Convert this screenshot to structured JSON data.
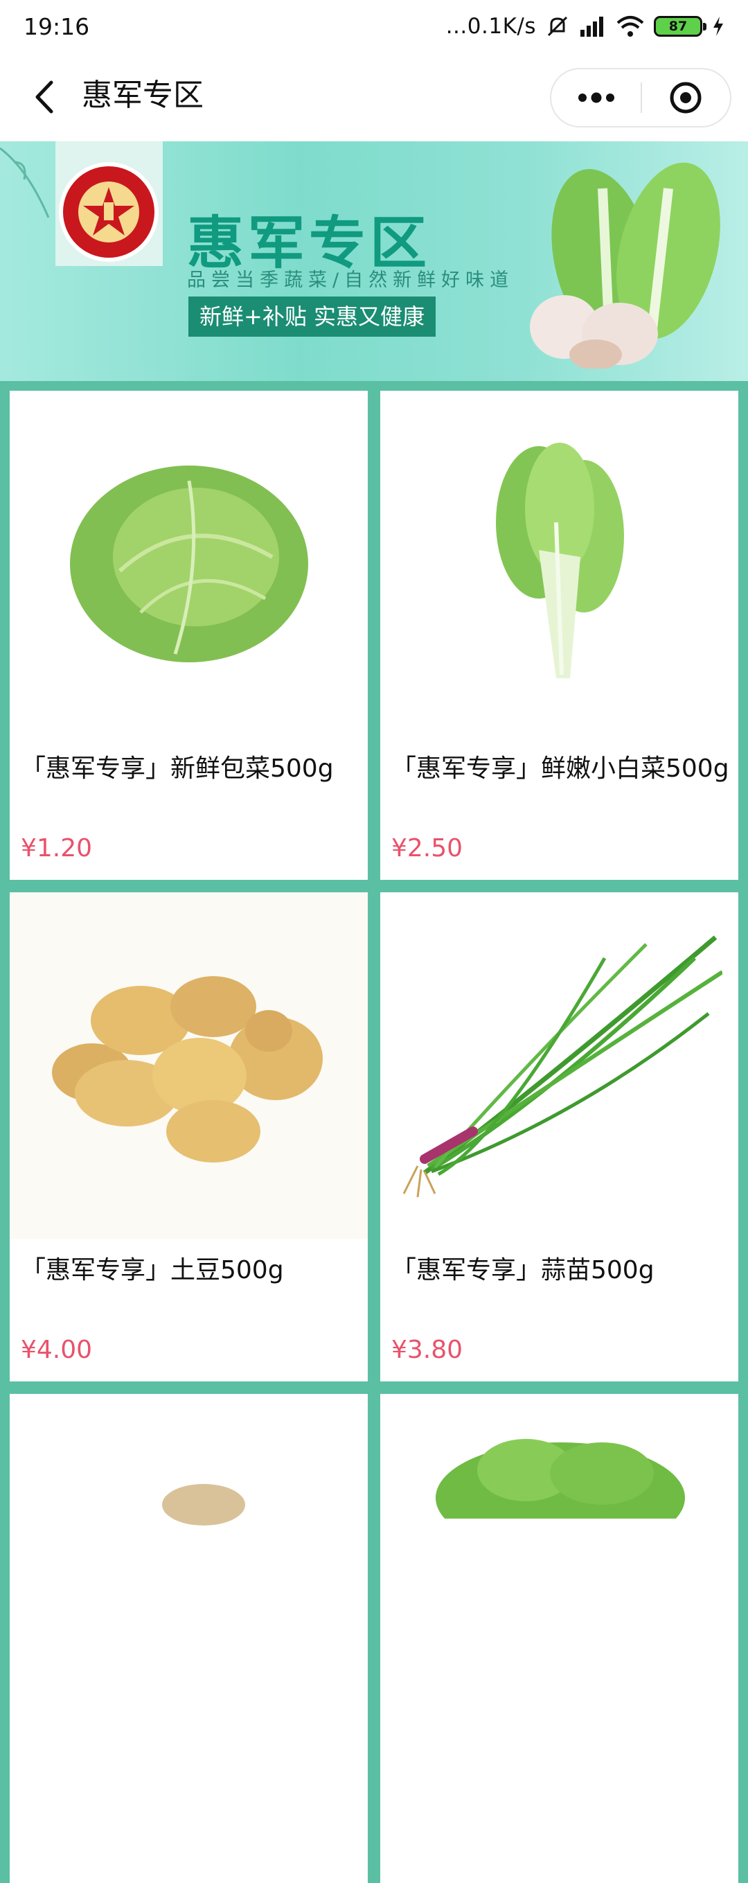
{
  "status_bar": {
    "time": "19:16",
    "net_speed": "...0.1K/s",
    "battery": "87"
  },
  "nav": {
    "title": "惠军专区"
  },
  "banner": {
    "title": "惠军专区",
    "subtitle": "品尝当季蔬菜/自然新鲜好味道",
    "pill": "新鲜+补贴 实惠又健康"
  },
  "products": [
    {
      "title": "「惠军专享」新鲜包菜500g",
      "price": "¥1.20",
      "icon": "cabbage"
    },
    {
      "title": "「惠军专享」鲜嫩小白菜500g",
      "price": "¥2.50",
      "icon": "bok-choy"
    },
    {
      "title": "「惠军专享」土豆500g",
      "price": "¥4.00",
      "icon": "potato"
    },
    {
      "title": "「惠军专享」蒜苗500g",
      "price": "¥3.80",
      "icon": "garlic-sprout"
    }
  ],
  "colors": {
    "accent": "#5bbfa3",
    "price": "#e8526b",
    "banner_title": "#109a7f"
  }
}
